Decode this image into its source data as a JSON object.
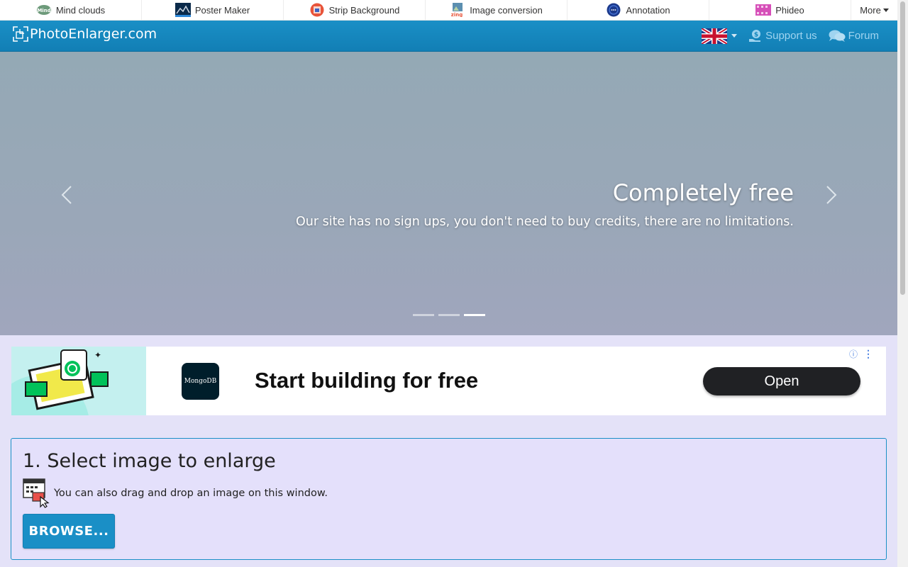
{
  "topbar": {
    "items": [
      {
        "label": "Mind clouds",
        "icon": "mind-clouds-icon"
      },
      {
        "label": "Poster Maker",
        "icon": "poster-maker-icon"
      },
      {
        "label": "Strip Background",
        "icon": "strip-background-icon"
      },
      {
        "label": "Image conversion",
        "icon": "image-conversion-icon"
      },
      {
        "label": "Annotation",
        "icon": "annotation-icon"
      },
      {
        "label": "Phideo",
        "icon": "phideo-icon"
      }
    ],
    "more_label": "More",
    "mind_icon_text": "Mind",
    "zing_icon_text": "zing"
  },
  "navbar": {
    "brand": "PhotoEnlarger.com",
    "support_label": "Support us",
    "forum_label": "Forum",
    "color": "#1a8fc6"
  },
  "carousel": {
    "title": "Completely free",
    "text": "Our site has no sign ups, you don't need to buy credits, there are no limitations.",
    "active_slide": 3,
    "slide_count": 3
  },
  "ad": {
    "logo_text": "MongoDB",
    "headline": "Start building for free",
    "cta": "Open",
    "info_glyph": "ⓘ",
    "menu_glyph": "⋮"
  },
  "step1": {
    "title": "1. Select image to enlarge",
    "hint": "You can also drag and drop an image on this window.",
    "browse_label": "BROWSE..."
  }
}
